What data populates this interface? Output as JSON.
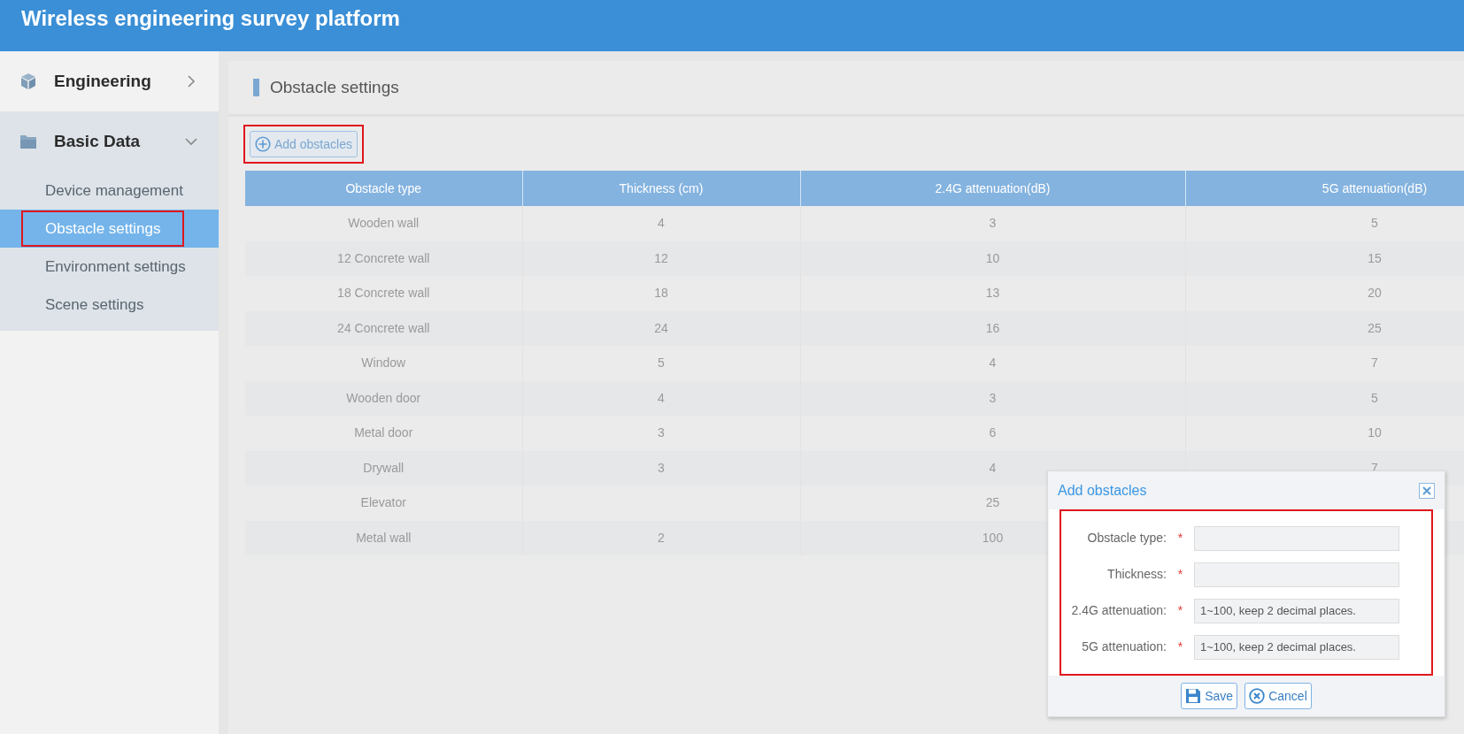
{
  "header": {
    "title": "Wireless engineering survey platform"
  },
  "sidebar": {
    "groups": [
      {
        "label": "Engineering",
        "expanded": false
      },
      {
        "label": "Basic Data",
        "expanded": true,
        "children": [
          {
            "label": "Device management",
            "selected": false,
            "highlighted": false
          },
          {
            "label": "Obstacle settings",
            "selected": true,
            "highlighted": true
          },
          {
            "label": "Environment settings",
            "selected": false,
            "highlighted": false
          },
          {
            "label": "Scene settings",
            "selected": false,
            "highlighted": false
          }
        ]
      }
    ]
  },
  "page": {
    "title": "Obstacle settings"
  },
  "toolbar": {
    "add_button": {
      "label": "Add obstacles",
      "highlighted": true
    }
  },
  "table": {
    "columns": [
      "Obstacle type",
      "Thickness (cm)",
      "2.4G attenuation(dB)",
      "5G attenuation(dB)"
    ],
    "rows": [
      [
        "Wooden wall",
        "4",
        "3",
        "5"
      ],
      [
        "12 Concrete wall",
        "12",
        "10",
        "15"
      ],
      [
        "18 Concrete wall",
        "18",
        "13",
        "20"
      ],
      [
        "24 Concrete wall",
        "24",
        "16",
        "25"
      ],
      [
        "Window",
        "5",
        "4",
        "7"
      ],
      [
        "Wooden door",
        "4",
        "3",
        "5"
      ],
      [
        "Metal door",
        "3",
        "6",
        "10"
      ],
      [
        "Drywall",
        "3",
        "4",
        "7"
      ],
      [
        "Elevator",
        null,
        "25",
        null
      ],
      [
        "Metal wall",
        "2",
        "100",
        null
      ]
    ]
  },
  "dialog": {
    "title": "Add obstacles",
    "highlighted": true,
    "fields": [
      {
        "label": "Obstacle type:",
        "required_mark": "*"
      },
      {
        "label": "Thickness:",
        "required_mark": "*"
      },
      {
        "label": "2.4G attenuation:",
        "required_mark": "*",
        "placeholder": "1~100, keep 2 decimal places."
      },
      {
        "label": "5G attenuation:",
        "required_mark": "*",
        "placeholder": "1~100, keep 2 decimal places."
      }
    ],
    "buttons": [
      {
        "kind": "save",
        "label": "Save"
      },
      {
        "kind": "cancel",
        "label": "Cancel"
      }
    ]
  }
}
